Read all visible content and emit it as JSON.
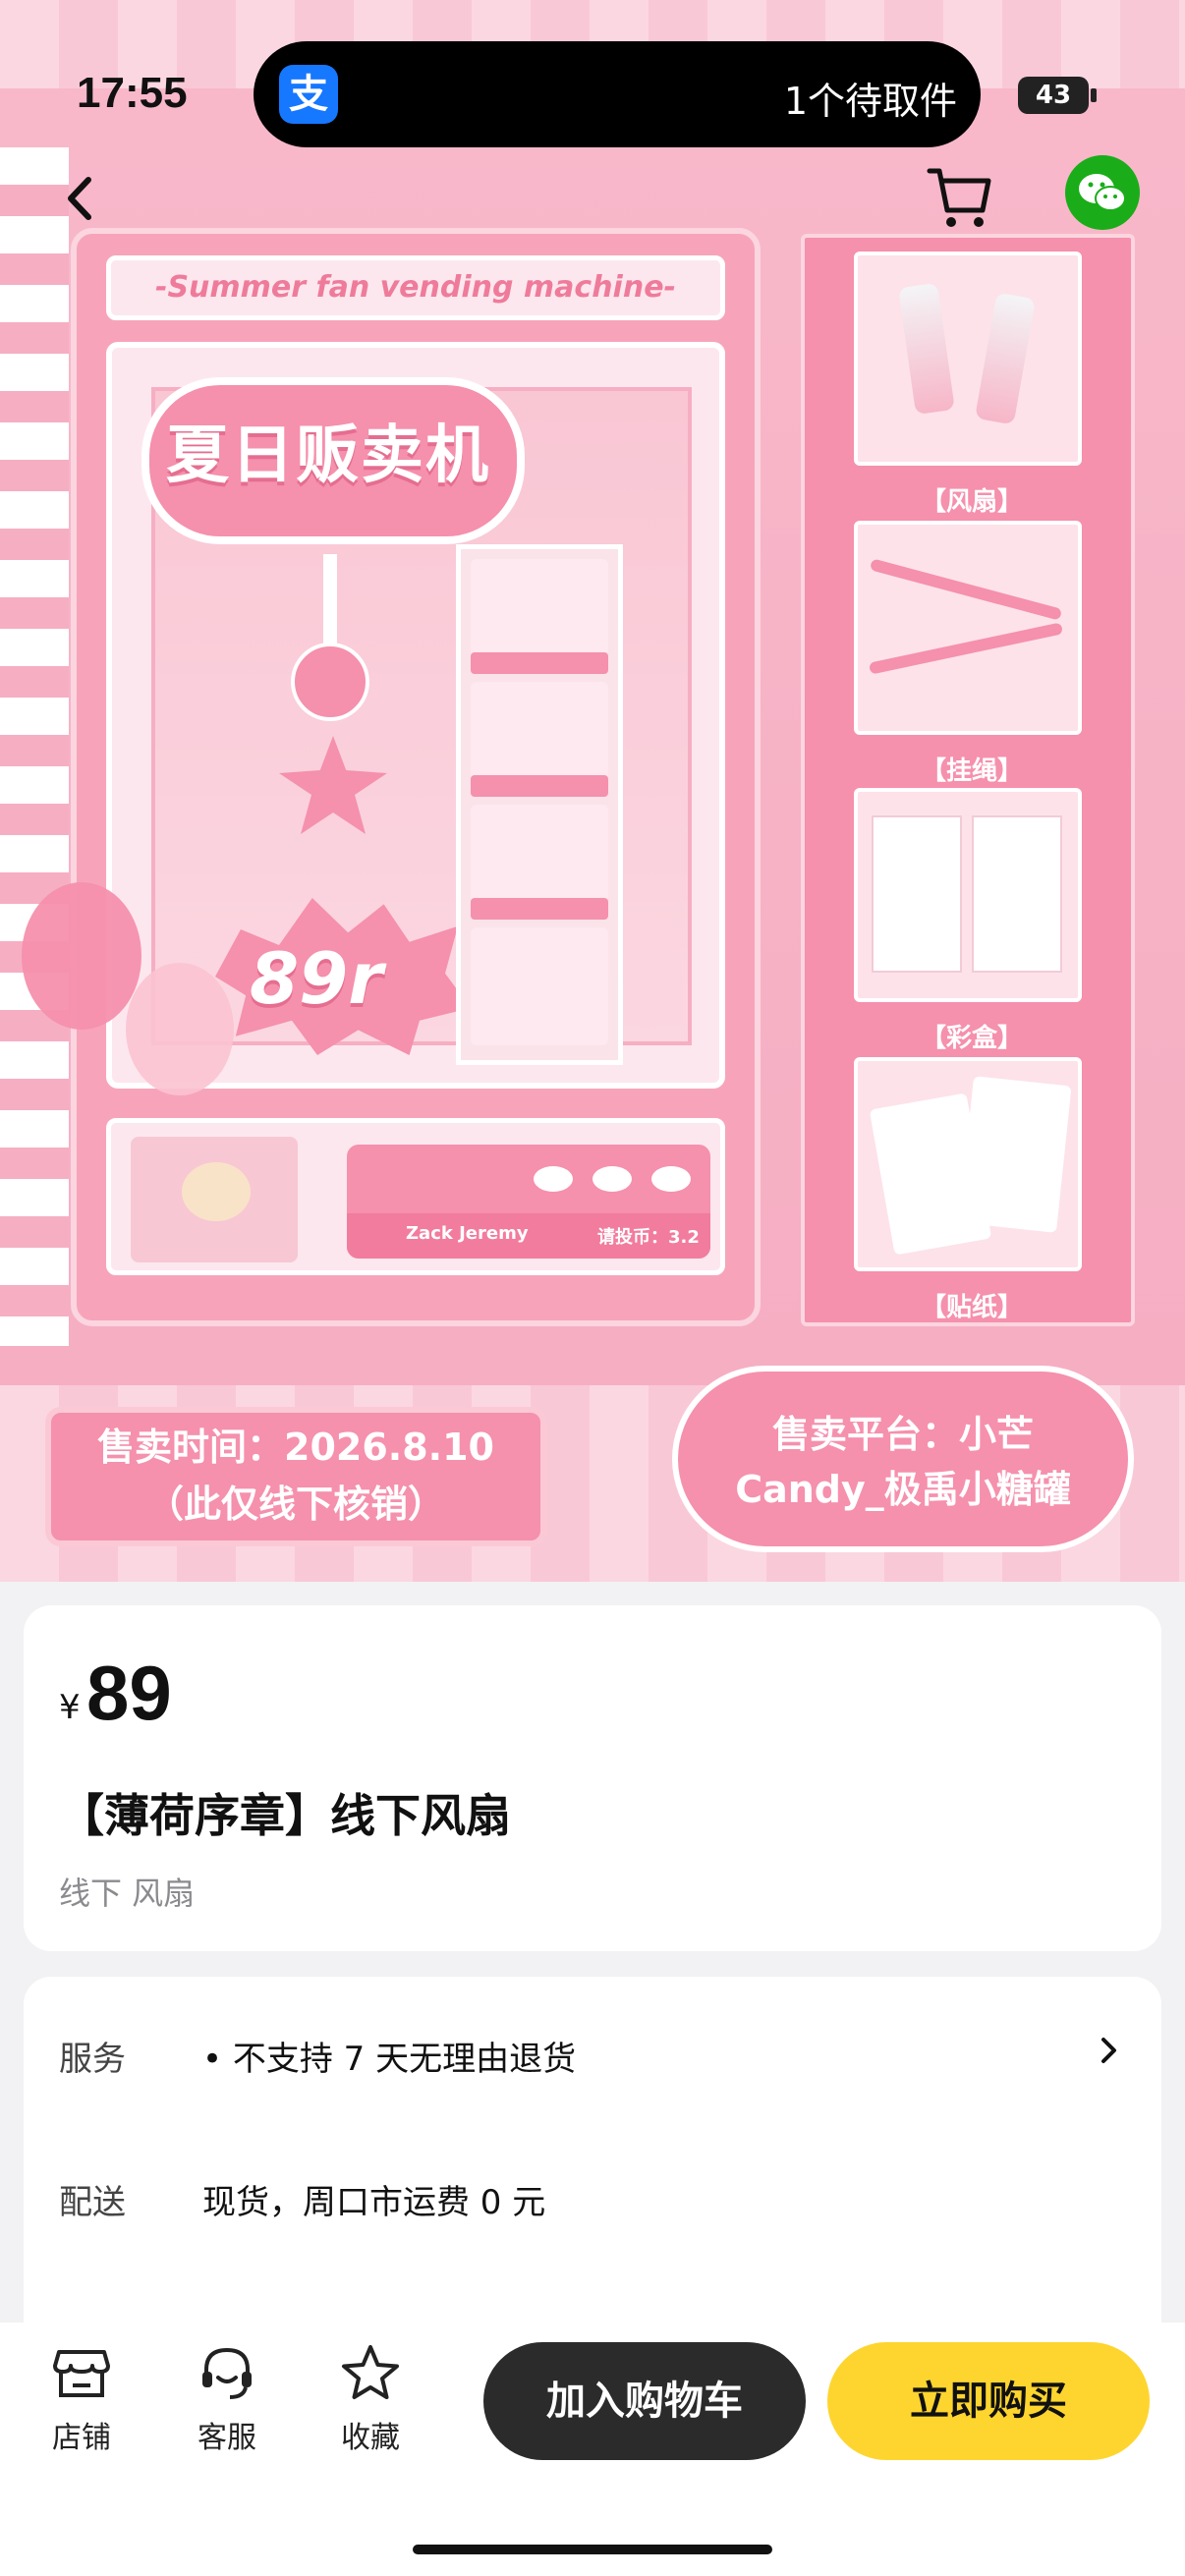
{
  "status": {
    "time": "17:55",
    "island_text": "1个待取件",
    "battery": "43",
    "alipay_glyph": "支"
  },
  "poster": {
    "machine_banner": "-Summer fan vending machine-",
    "title_cn": "夏日贩卖机",
    "price_burst": "89r",
    "panel_names": "Zack Jeremy",
    "panel_coin": "请投币：3.2",
    "side_items": [
      "【风扇】",
      "【挂绳】",
      "【彩盒】",
      "【贴纸】"
    ],
    "sale_time_line1": "售卖时间：2026.8.10",
    "sale_time_line2": "（此仅线下核销）",
    "sale_platform_line1": "售卖平台：小芒",
    "sale_platform_line2": "Candy_极禹小糖罐"
  },
  "product": {
    "currency": "¥",
    "price": "89",
    "title": "【薄荷序章】线下风扇",
    "tags": "线下 风扇"
  },
  "service": {
    "rows": [
      {
        "label": "服务",
        "value": "• 不支持 7 天无理由退货"
      },
      {
        "label": "配送",
        "value": "现货，周口市运费 0 元"
      }
    ]
  },
  "bottom": {
    "tabs": [
      {
        "label": "店铺",
        "icon": "store-icon"
      },
      {
        "label": "客服",
        "icon": "headset-icon"
      },
      {
        "label": "收藏",
        "icon": "star-icon"
      }
    ],
    "add_cart": "加入购物车",
    "buy_now": "立即购买"
  },
  "colors": {
    "accent_pink": "#f590ad",
    "buy_yellow": "#fed52e",
    "cart_dark": "#2b2b2b",
    "wechat_green": "#1aad19"
  }
}
